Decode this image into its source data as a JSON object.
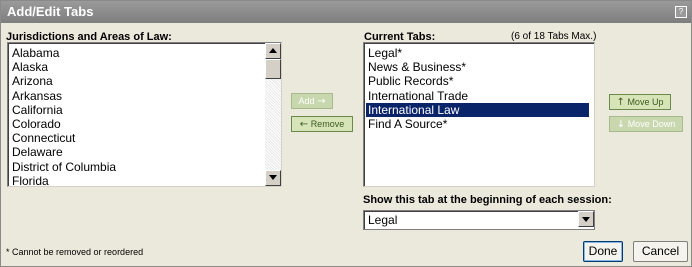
{
  "dialog": {
    "title": "Add/Edit Tabs",
    "help_glyph": "?"
  },
  "left_panel": {
    "label": "Jurisdictions and Areas of Law:",
    "items": [
      "Alabama",
      "Alaska",
      "Arizona",
      "Arkansas",
      "California",
      "Colorado",
      "Connecticut",
      "Delaware",
      "District of Columbia",
      "Florida"
    ]
  },
  "middle_buttons": {
    "add": {
      "label": "Add",
      "arrow": "→"
    },
    "remove": {
      "label": "Remove",
      "arrow": "←"
    }
  },
  "right_panel": {
    "label": "Current Tabs:",
    "max_note": "(6 of 18 Tabs Max.)",
    "items": [
      "Legal*",
      "News & Business*",
      "Public Records*",
      "International Trade",
      "International Law",
      "Find A Source*"
    ],
    "selected_item": "International Law"
  },
  "order_buttons": {
    "move_up": {
      "label": "Move Up",
      "arrow": "↑"
    },
    "move_down": {
      "label": "Move Down",
      "arrow": "↓"
    }
  },
  "session": {
    "label": "Show this tab at the beginning of each session:",
    "selected": "Legal"
  },
  "footer": {
    "footnote": "* Cannot be removed or reordered",
    "done": "Done",
    "cancel": "Cancel"
  }
}
